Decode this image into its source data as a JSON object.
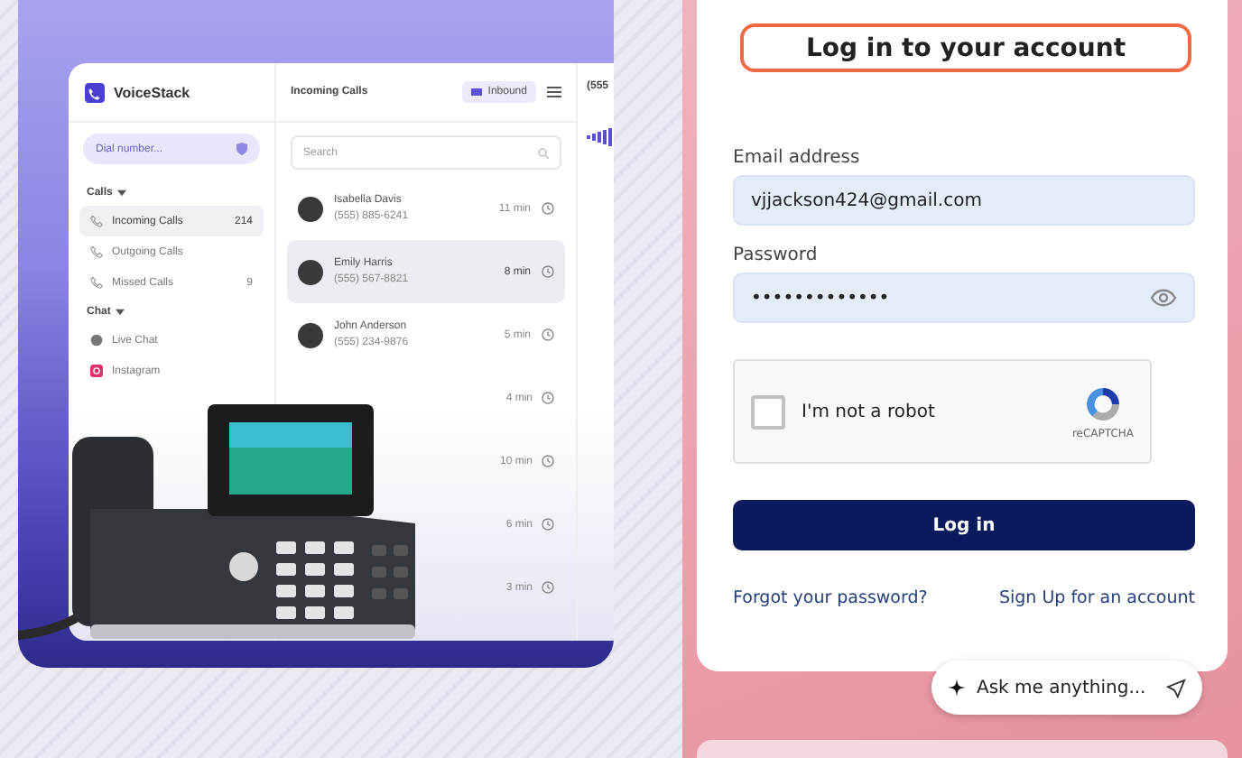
{
  "app": {
    "brand": "VoiceStack",
    "dial_placeholder": "Dial number...",
    "sections": [
      {
        "title": "Calls",
        "items": [
          {
            "kind": "incoming",
            "label": "Incoming Calls",
            "count": "214",
            "selected": true
          },
          {
            "kind": "outgoing",
            "label": "Outgoing Calls",
            "selected": false
          },
          {
            "kind": "missed",
            "label": "Missed Calls",
            "count": "9",
            "selected": false
          }
        ]
      },
      {
        "title": "Chat",
        "items": [
          {
            "kind": "livechat",
            "label": "Live Chat",
            "selected": false
          },
          {
            "kind": "instagram",
            "label": "Instagram",
            "selected": false
          }
        ]
      }
    ],
    "list": {
      "title": "Incoming Calls",
      "filter": "Inbound",
      "search_placeholder": "Search",
      "calls": [
        {
          "name": "Isabella Davis",
          "phone": "(555) 885-6241",
          "time": "11 min",
          "selected": false
        },
        {
          "name": "Emily Harris",
          "phone": "(555) 567-8821",
          "time": "8 min",
          "selected": true
        },
        {
          "name": "John Anderson",
          "phone": "(555) 234-9876",
          "time": "5 min",
          "selected": false
        },
        {
          "time": "4 min",
          "selected": false
        },
        {
          "time": "10 min",
          "selected": false
        },
        {
          "time": "6 min",
          "selected": false
        },
        {
          "time": "3 min",
          "selected": false
        }
      ]
    },
    "detail": {
      "title": "(555"
    }
  },
  "login": {
    "title": "Log in to your account",
    "email_label": "Email address",
    "email": "vjjackson424@gmail.com",
    "password_label": "Password",
    "password": "•••••••••••••",
    "captcha": {
      "label": "I'm not a robot",
      "brand": "reCAPTCHA",
      "checked": false
    },
    "submit": "Log in",
    "forgot": "Forgot your password?",
    "signup": "Sign Up for an account"
  },
  "assistant": {
    "placeholder": "Ask me anything..."
  }
}
